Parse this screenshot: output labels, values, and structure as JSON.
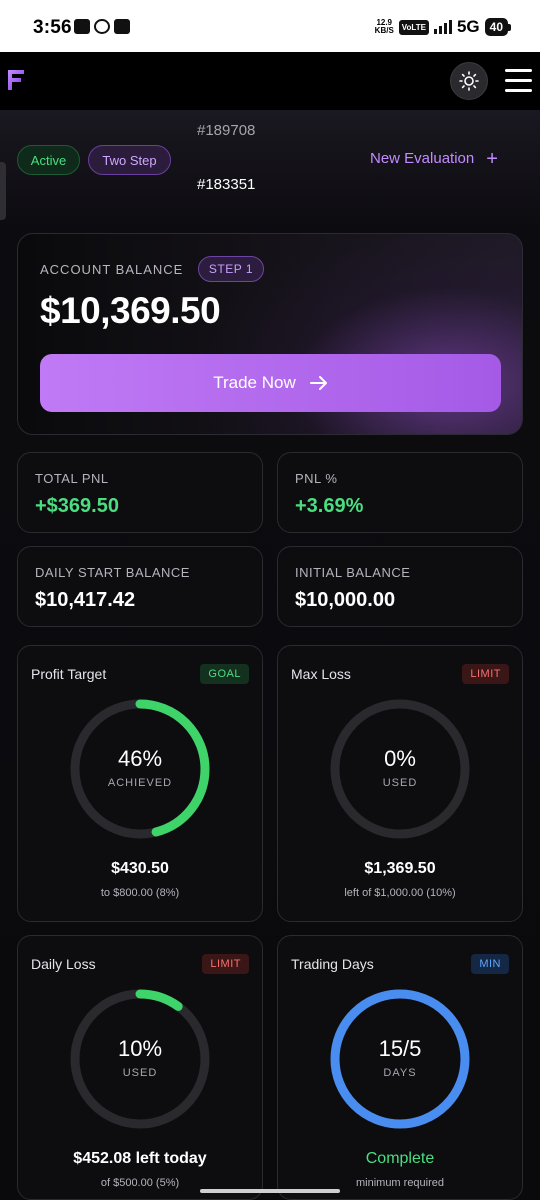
{
  "status_bar": {
    "time": "3:56",
    "speed_value": "12.9",
    "speed_unit": "KB/S",
    "volte": "VoLTE",
    "network": "5G",
    "battery": "40"
  },
  "header": {
    "logo_letter": "F"
  },
  "account": {
    "status_badge": "Active",
    "type_badge": "Two Step",
    "ids": [
      "#189708",
      "#183351"
    ],
    "new_evaluation": "New Evaluation",
    "new_evaluation_icon": "plus-icon"
  },
  "balance_card": {
    "label": "ACCOUNT BALANCE",
    "step": "STEP 1",
    "value": "$10,369.50",
    "trade_button": "Trade Now",
    "trade_icon": "arrow-right-icon",
    "accent": "#b86ef0"
  },
  "stats": [
    {
      "label": "TOTAL PNL",
      "value": "+$369.50",
      "positive": true
    },
    {
      "label": "PNL %",
      "value": "+3.69%",
      "positive": true
    },
    {
      "label": "DAILY START BALANCE",
      "value": "$10,417.42",
      "positive": false
    },
    {
      "label": "INITIAL BALANCE",
      "value": "$10,000.00",
      "positive": false
    }
  ],
  "gauges": [
    {
      "title": "Profit Target",
      "badge": "GOAL",
      "badge_type": "goal",
      "percent_label": "46%",
      "sub": "ACHIEVED",
      "progress": 0.46,
      "color": "#3fd46a",
      "amount": "$430.50",
      "note": "to $800.00 (8%)"
    },
    {
      "title": "Max Loss",
      "badge": "LIMIT",
      "badge_type": "limit",
      "percent_label": "0%",
      "sub": "USED",
      "progress": 0.0,
      "color": "#f87171",
      "amount": "$1,369.50",
      "note": "left of $1,000.00 (10%)"
    },
    {
      "title": "Daily Loss",
      "badge": "LIMIT",
      "badge_type": "limit",
      "percent_label": "10%",
      "sub": "USED",
      "progress": 0.1,
      "color": "#3fd46a",
      "amount": "$452.08 left today",
      "note": "of $500.00 (5%)"
    },
    {
      "title": "Trading Days",
      "badge": "MIN",
      "badge_type": "min",
      "percent_label": "15/5",
      "sub": "DAYS",
      "progress": 1.0,
      "color": "#4a8df0",
      "amount": "Complete",
      "note": "minimum required"
    }
  ],
  "colors": {
    "positive": "#4ade80",
    "purple": "#c28cff",
    "track": "#2a2a2e"
  }
}
